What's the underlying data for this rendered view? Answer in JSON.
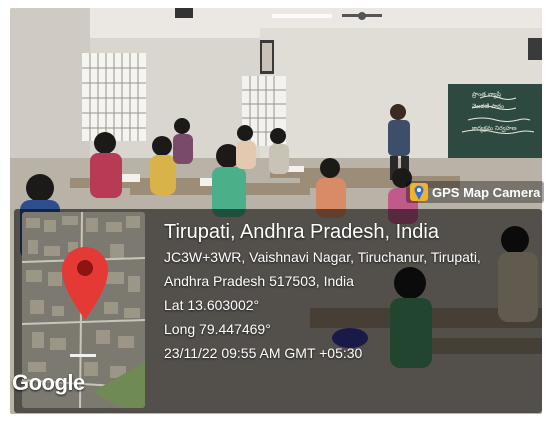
{
  "app_badge": {
    "label": "GPS Map Camera",
    "icon": "gps-map-camera-icon"
  },
  "location": {
    "place": "Tirupati, Andhra Pradesh, India",
    "address_line1": "JC3W+3WR, Vaishnavi Nagar, Tiruchanur, Tirupati,",
    "address_line2": "Andhra Pradesh 517503, India",
    "latitude": "Lat 13.603002°",
    "longitude": "Long 79.447469°",
    "timestamp": "23/11/22 09:55 AM GMT +05:30"
  },
  "map": {
    "attribution": "Google",
    "pin_color": "#e53935",
    "icon": "map-pin-icon"
  },
  "board_text": [
    "ప్రాంత వ్యాప్తి",
    "మొదటి పాఠం",
    "కార్యక్రమ నిర్వహణ"
  ]
}
